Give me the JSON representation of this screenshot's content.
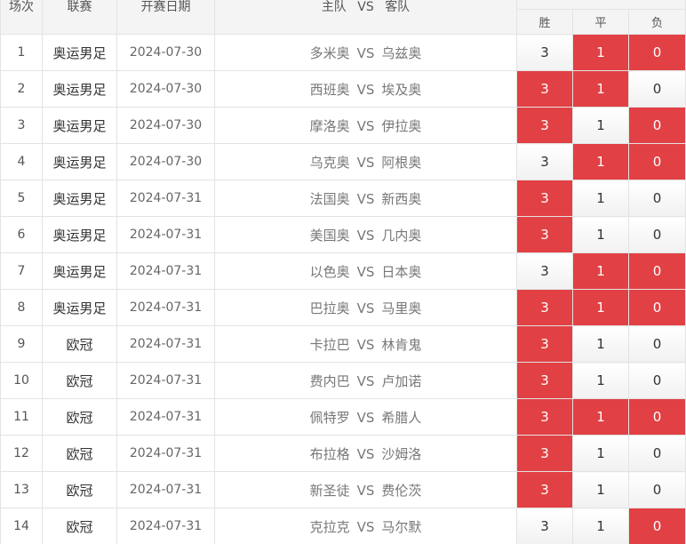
{
  "header": {
    "index": "场次",
    "league": "联赛",
    "date": "开赛日期",
    "home": "主队",
    "vs": "VS",
    "away": "客队",
    "win": "胜",
    "draw": "平",
    "loss": "负"
  },
  "colors": {
    "selected": "#e14044",
    "unselected_top": "#ffffff",
    "unselected_bottom": "#f1f1f1"
  },
  "matches": [
    {
      "index": "1",
      "league": "奥运男足",
      "date": "2024-07-30",
      "home": "多米奥",
      "vs": "VS",
      "away": "乌兹奥",
      "win": "3",
      "draw": "1",
      "loss": "0",
      "selected": {
        "win": false,
        "draw": true,
        "loss": true
      }
    },
    {
      "index": "2",
      "league": "奥运男足",
      "date": "2024-07-30",
      "home": "西班奥",
      "vs": "VS",
      "away": "埃及奥",
      "win": "3",
      "draw": "1",
      "loss": "0",
      "selected": {
        "win": true,
        "draw": true,
        "loss": false
      }
    },
    {
      "index": "3",
      "league": "奥运男足",
      "date": "2024-07-30",
      "home": "摩洛奥",
      "vs": "VS",
      "away": "伊拉奥",
      "win": "3",
      "draw": "1",
      "loss": "0",
      "selected": {
        "win": true,
        "draw": false,
        "loss": true
      }
    },
    {
      "index": "4",
      "league": "奥运男足",
      "date": "2024-07-30",
      "home": "乌克奥",
      "vs": "VS",
      "away": "阿根奥",
      "win": "3",
      "draw": "1",
      "loss": "0",
      "selected": {
        "win": false,
        "draw": true,
        "loss": true
      }
    },
    {
      "index": "5",
      "league": "奥运男足",
      "date": "2024-07-31",
      "home": "法国奥",
      "vs": "VS",
      "away": "新西奥",
      "win": "3",
      "draw": "1",
      "loss": "0",
      "selected": {
        "win": true,
        "draw": false,
        "loss": false
      }
    },
    {
      "index": "6",
      "league": "奥运男足",
      "date": "2024-07-31",
      "home": "美国奥",
      "vs": "VS",
      "away": "几内奥",
      "win": "3",
      "draw": "1",
      "loss": "0",
      "selected": {
        "win": true,
        "draw": false,
        "loss": false
      }
    },
    {
      "index": "7",
      "league": "奥运男足",
      "date": "2024-07-31",
      "home": "以色奥",
      "vs": "VS",
      "away": "日本奥",
      "win": "3",
      "draw": "1",
      "loss": "0",
      "selected": {
        "win": false,
        "draw": true,
        "loss": true
      }
    },
    {
      "index": "8",
      "league": "奥运男足",
      "date": "2024-07-31",
      "home": "巴拉奥",
      "vs": "VS",
      "away": "马里奥",
      "win": "3",
      "draw": "1",
      "loss": "0",
      "selected": {
        "win": true,
        "draw": true,
        "loss": true
      }
    },
    {
      "index": "9",
      "league": "欧冠",
      "date": "2024-07-31",
      "home": "卡拉巴",
      "vs": "VS",
      "away": "林肯鬼",
      "win": "3",
      "draw": "1",
      "loss": "0",
      "selected": {
        "win": true,
        "draw": false,
        "loss": false
      }
    },
    {
      "index": "10",
      "league": "欧冠",
      "date": "2024-07-31",
      "home": "费内巴",
      "vs": "VS",
      "away": "卢加诺",
      "win": "3",
      "draw": "1",
      "loss": "0",
      "selected": {
        "win": true,
        "draw": false,
        "loss": false
      }
    },
    {
      "index": "11",
      "league": "欧冠",
      "date": "2024-07-31",
      "home": "佩特罗",
      "vs": "VS",
      "away": "希腊人",
      "win": "3",
      "draw": "1",
      "loss": "0",
      "selected": {
        "win": true,
        "draw": true,
        "loss": true
      }
    },
    {
      "index": "12",
      "league": "欧冠",
      "date": "2024-07-31",
      "home": "布拉格",
      "vs": "VS",
      "away": "沙姆洛",
      "win": "3",
      "draw": "1",
      "loss": "0",
      "selected": {
        "win": true,
        "draw": false,
        "loss": false
      }
    },
    {
      "index": "13",
      "league": "欧冠",
      "date": "2024-07-31",
      "home": "新圣徒",
      "vs": "VS",
      "away": "费伦茨",
      "win": "3",
      "draw": "1",
      "loss": "0",
      "selected": {
        "win": true,
        "draw": false,
        "loss": false
      }
    },
    {
      "index": "14",
      "league": "欧冠",
      "date": "2024-07-31",
      "home": "克拉克",
      "vs": "VS",
      "away": "马尔默",
      "win": "3",
      "draw": "1",
      "loss": "0",
      "selected": {
        "win": false,
        "draw": false,
        "loss": true
      }
    }
  ]
}
